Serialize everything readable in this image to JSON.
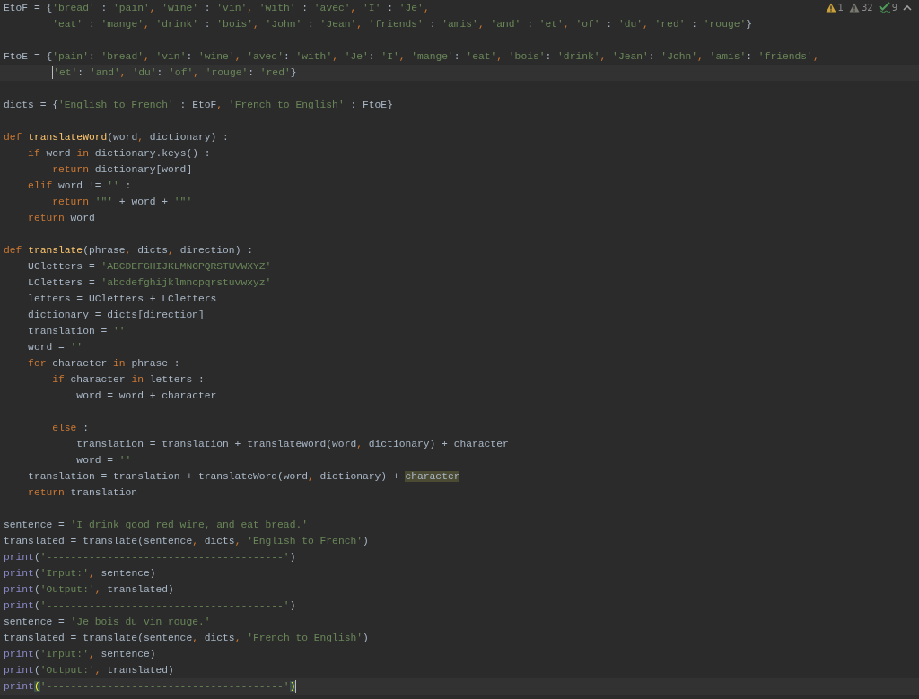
{
  "inspections": [
    {
      "kind": "warning",
      "count": "1"
    },
    {
      "kind": "weak-warning",
      "count": "32"
    },
    {
      "kind": "typo",
      "count": "9"
    }
  ],
  "editor": {
    "lines": [
      {
        "current": false,
        "tokens": [
          {
            "kind": "id",
            "text": "EtoF = {"
          },
          {
            "kind": "str",
            "text": "'bread'"
          },
          {
            "kind": "id",
            "text": " : "
          },
          {
            "kind": "str",
            "text": "'pain'"
          },
          {
            "kind": "comma",
            "text": ", "
          },
          {
            "kind": "str",
            "text": "'wine'"
          },
          {
            "kind": "id",
            "text": " : "
          },
          {
            "kind": "str",
            "text": "'vin'"
          },
          {
            "kind": "comma",
            "text": ", "
          },
          {
            "kind": "str",
            "text": "'with'"
          },
          {
            "kind": "id",
            "text": " : "
          },
          {
            "kind": "str",
            "text": "'avec'"
          },
          {
            "kind": "comma",
            "text": ", "
          },
          {
            "kind": "str",
            "text": "'I'"
          },
          {
            "kind": "id",
            "text": " : "
          },
          {
            "kind": "str",
            "text": "'Je'"
          },
          {
            "kind": "comma",
            "text": ","
          }
        ]
      },
      {
        "current": false,
        "tokens": [
          {
            "kind": "str",
            "text": "        'eat'"
          },
          {
            "kind": "id",
            "text": " : "
          },
          {
            "kind": "str",
            "text": "'mange'"
          },
          {
            "kind": "comma",
            "text": ", "
          },
          {
            "kind": "str",
            "text": "'drink'"
          },
          {
            "kind": "id",
            "text": " : "
          },
          {
            "kind": "str",
            "text": "'bois'"
          },
          {
            "kind": "comma",
            "text": ", "
          },
          {
            "kind": "str",
            "text": "'John'"
          },
          {
            "kind": "id",
            "text": " : "
          },
          {
            "kind": "str",
            "text": "'Jean'"
          },
          {
            "kind": "comma",
            "text": ", "
          },
          {
            "kind": "str",
            "text": "'friends'"
          },
          {
            "kind": "id",
            "text": " : "
          },
          {
            "kind": "str",
            "text": "'amis'"
          },
          {
            "kind": "comma",
            "text": ", "
          },
          {
            "kind": "str",
            "text": "'and'"
          },
          {
            "kind": "id",
            "text": " : "
          },
          {
            "kind": "str",
            "text": "'et'"
          },
          {
            "kind": "comma",
            "text": ", "
          },
          {
            "kind": "str",
            "text": "'of'"
          },
          {
            "kind": "id",
            "text": " : "
          },
          {
            "kind": "str",
            "text": "'du'"
          },
          {
            "kind": "comma",
            "text": ", "
          },
          {
            "kind": "str",
            "text": "'red'"
          },
          {
            "kind": "id",
            "text": " : "
          },
          {
            "kind": "str",
            "text": "'rouge'"
          },
          {
            "kind": "id",
            "text": "}"
          }
        ]
      },
      {
        "current": false
      },
      {
        "current": false,
        "tokens": [
          {
            "kind": "id",
            "text": "FtoE = {"
          },
          {
            "kind": "str",
            "text": "'pain'"
          },
          {
            "kind": "id",
            "text": ": "
          },
          {
            "kind": "str",
            "text": "'bread'"
          },
          {
            "kind": "comma",
            "text": ", "
          },
          {
            "kind": "str",
            "text": "'vin'"
          },
          {
            "kind": "id",
            "text": ": "
          },
          {
            "kind": "str",
            "text": "'wine'"
          },
          {
            "kind": "comma",
            "text": ", "
          },
          {
            "kind": "str",
            "text": "'avec'"
          },
          {
            "kind": "id",
            "text": ": "
          },
          {
            "kind": "str",
            "text": "'with'"
          },
          {
            "kind": "comma",
            "text": ", "
          },
          {
            "kind": "str",
            "text": "'Je'"
          },
          {
            "kind": "id",
            "text": ": "
          },
          {
            "kind": "str",
            "text": "'I'"
          },
          {
            "kind": "comma",
            "text": ", "
          },
          {
            "kind": "str",
            "text": "'mange'"
          },
          {
            "kind": "id",
            "text": ": "
          },
          {
            "kind": "str",
            "text": "'eat'"
          },
          {
            "kind": "comma",
            "text": ", "
          },
          {
            "kind": "str",
            "text": "'bois'"
          },
          {
            "kind": "id",
            "text": ": "
          },
          {
            "kind": "str",
            "text": "'drink'"
          },
          {
            "kind": "comma",
            "text": ", "
          },
          {
            "kind": "str",
            "text": "'Jean'"
          },
          {
            "kind": "id",
            "text": ": "
          },
          {
            "kind": "str",
            "text": "'John'"
          },
          {
            "kind": "comma",
            "text": ", "
          },
          {
            "kind": "str",
            "text": "'amis'"
          },
          {
            "kind": "id",
            "text": ": "
          },
          {
            "kind": "str",
            "text": "'friends'"
          },
          {
            "kind": "comma",
            "text": ","
          }
        ]
      },
      {
        "current": true,
        "tokens": [
          {
            "kind": "caret-str",
            "text": "        'et'"
          },
          {
            "kind": "id",
            "text": ": "
          },
          {
            "kind": "str",
            "text": "'and'"
          },
          {
            "kind": "comma",
            "text": ", "
          },
          {
            "kind": "str",
            "text": "'du'"
          },
          {
            "kind": "id",
            "text": ": "
          },
          {
            "kind": "str",
            "text": "'of'"
          },
          {
            "kind": "comma",
            "text": ", "
          },
          {
            "kind": "str",
            "text": "'rouge'"
          },
          {
            "kind": "id",
            "text": ": "
          },
          {
            "kind": "str",
            "text": "'red'"
          },
          {
            "kind": "id",
            "text": "}"
          }
        ]
      },
      {
        "current": false
      },
      {
        "current": false,
        "tokens": [
          {
            "kind": "id",
            "text": "dicts = {"
          },
          {
            "kind": "str",
            "text": "'English to French'"
          },
          {
            "kind": "id",
            "text": " : EtoF"
          },
          {
            "kind": "comma",
            "text": ", "
          },
          {
            "kind": "str",
            "text": "'French to English'"
          },
          {
            "kind": "id",
            "text": " : FtoE}"
          }
        ]
      },
      {
        "current": false
      },
      {
        "current": false,
        "tokens": [
          {
            "kind": "kw",
            "text": "def "
          },
          {
            "kind": "fn",
            "text": "translateWord"
          },
          {
            "kind": "id",
            "text": "(word"
          },
          {
            "kind": "comma",
            "text": ", "
          },
          {
            "kind": "id",
            "text": "dictionary) :"
          }
        ]
      },
      {
        "current": false,
        "tokens": [
          {
            "kind": "kw",
            "text": "    if "
          },
          {
            "kind": "id",
            "text": "word "
          },
          {
            "kind": "kw",
            "text": "in "
          },
          {
            "kind": "id",
            "text": "dictionary.keys() :"
          }
        ]
      },
      {
        "current": false,
        "tokens": [
          {
            "kind": "kw",
            "text": "        return "
          },
          {
            "kind": "id",
            "text": "dictionary[word]"
          }
        ]
      },
      {
        "current": false,
        "tokens": [
          {
            "kind": "kw",
            "text": "    elif "
          },
          {
            "kind": "id",
            "text": "word != "
          },
          {
            "kind": "str",
            "text": "''"
          },
          {
            "kind": "id",
            "text": " :"
          }
        ]
      },
      {
        "current": false,
        "tokens": [
          {
            "kind": "kw",
            "text": "        return "
          },
          {
            "kind": "str",
            "text": "'\"'"
          },
          {
            "kind": "id",
            "text": " + word + "
          },
          {
            "kind": "str",
            "text": "'\"'"
          }
        ]
      },
      {
        "current": false,
        "tokens": [
          {
            "kind": "kw",
            "text": "    return "
          },
          {
            "kind": "id",
            "text": "word"
          }
        ]
      },
      {
        "current": false
      },
      {
        "current": false,
        "tokens": [
          {
            "kind": "kw",
            "text": "def "
          },
          {
            "kind": "fn",
            "text": "translate"
          },
          {
            "kind": "id",
            "text": "(phrase"
          },
          {
            "kind": "comma",
            "text": ", "
          },
          {
            "kind": "id",
            "text": "dicts"
          },
          {
            "kind": "comma",
            "text": ", "
          },
          {
            "kind": "id",
            "text": "direction) :"
          }
        ]
      },
      {
        "current": false,
        "tokens": [
          {
            "kind": "id",
            "text": "    UCletters = "
          },
          {
            "kind": "str",
            "text": "'ABCDEFGHIJKLMNOPQRSTUVWXYZ'"
          }
        ]
      },
      {
        "current": false,
        "tokens": [
          {
            "kind": "id",
            "text": "    LCletters = "
          },
          {
            "kind": "str",
            "text": "'abcdefghijklmnopqrstuvwxyz'"
          }
        ]
      },
      {
        "current": false,
        "tokens": [
          {
            "kind": "id",
            "text": "    letters = UCletters + LCletters"
          }
        ]
      },
      {
        "current": false,
        "tokens": [
          {
            "kind": "id",
            "text": "    dictionary = dicts[direction]"
          }
        ]
      },
      {
        "current": false,
        "tokens": [
          {
            "kind": "id",
            "text": "    translation = "
          },
          {
            "kind": "str",
            "text": "''"
          }
        ]
      },
      {
        "current": false,
        "tokens": [
          {
            "kind": "id",
            "text": "    word = "
          },
          {
            "kind": "str",
            "text": "''"
          }
        ]
      },
      {
        "current": false,
        "tokens": [
          {
            "kind": "kw",
            "text": "    for "
          },
          {
            "kind": "id",
            "text": "character "
          },
          {
            "kind": "kw",
            "text": "in "
          },
          {
            "kind": "id",
            "text": "phrase :"
          }
        ]
      },
      {
        "current": false,
        "tokens": [
          {
            "kind": "kw",
            "text": "        if "
          },
          {
            "kind": "id",
            "text": "character "
          },
          {
            "kind": "kw",
            "text": "in "
          },
          {
            "kind": "id",
            "text": "letters :"
          }
        ]
      },
      {
        "current": false,
        "tokens": [
          {
            "kind": "id",
            "text": "            word = word + character"
          }
        ]
      },
      {
        "current": false
      },
      {
        "current": false,
        "tokens": [
          {
            "kind": "kw",
            "text": "        else"
          },
          {
            "kind": "id",
            "text": " :"
          }
        ]
      },
      {
        "current": false,
        "tokens": [
          {
            "kind": "id",
            "text": "            translation = translation + translateWord(word"
          },
          {
            "kind": "comma",
            "text": ", "
          },
          {
            "kind": "id",
            "text": "dictionary) + character"
          }
        ]
      },
      {
        "current": false,
        "tokens": [
          {
            "kind": "id",
            "text": "            word = "
          },
          {
            "kind": "str",
            "text": "''"
          }
        ]
      },
      {
        "current": false,
        "tokens": [
          {
            "kind": "id",
            "text": "    translation = translation + translateWord(word"
          },
          {
            "kind": "comma",
            "text": ", "
          },
          {
            "kind": "id",
            "text": "dictionary) + "
          },
          {
            "kind": "match",
            "text": "character"
          }
        ]
      },
      {
        "current": false,
        "tokens": [
          {
            "kind": "kw",
            "text": "    return "
          },
          {
            "kind": "id",
            "text": "translation"
          }
        ]
      },
      {
        "current": false
      },
      {
        "current": false,
        "tokens": [
          {
            "kind": "id",
            "text": "sentence = "
          },
          {
            "kind": "str",
            "text": "'I drink good red wine, and eat bread.'"
          }
        ]
      },
      {
        "current": false,
        "tokens": [
          {
            "kind": "id",
            "text": "translated = translate(sentence"
          },
          {
            "kind": "comma",
            "text": ", "
          },
          {
            "kind": "id",
            "text": "dicts"
          },
          {
            "kind": "comma",
            "text": ", "
          },
          {
            "kind": "str",
            "text": "'English to French'"
          },
          {
            "kind": "id",
            "text": ")"
          }
        ]
      },
      {
        "current": false,
        "tokens": [
          {
            "kind": "builtin",
            "text": "print"
          },
          {
            "kind": "id",
            "text": "("
          },
          {
            "kind": "str",
            "text": "'---------------------------------------'"
          },
          {
            "kind": "id",
            "text": ")"
          }
        ]
      },
      {
        "current": false,
        "tokens": [
          {
            "kind": "builtin",
            "text": "print"
          },
          {
            "kind": "id",
            "text": "("
          },
          {
            "kind": "str",
            "text": "'Input:'"
          },
          {
            "kind": "comma",
            "text": ", "
          },
          {
            "kind": "id",
            "text": "sentence)"
          }
        ]
      },
      {
        "current": false,
        "tokens": [
          {
            "kind": "builtin",
            "text": "print"
          },
          {
            "kind": "id",
            "text": "("
          },
          {
            "kind": "str",
            "text": "'Output:'"
          },
          {
            "kind": "comma",
            "text": ", "
          },
          {
            "kind": "id",
            "text": "translated)"
          }
        ]
      },
      {
        "current": false,
        "tokens": [
          {
            "kind": "builtin",
            "text": "print"
          },
          {
            "kind": "id",
            "text": "("
          },
          {
            "kind": "str",
            "text": "'---------------------------------------'"
          },
          {
            "kind": "id",
            "text": ")"
          }
        ]
      },
      {
        "current": false,
        "tokens": [
          {
            "kind": "id",
            "text": "sentence = "
          },
          {
            "kind": "str",
            "text": "'Je bois du vin rouge.'"
          }
        ]
      },
      {
        "current": false,
        "tokens": [
          {
            "kind": "id",
            "text": "translated = translate(sentence"
          },
          {
            "kind": "comma",
            "text": ", "
          },
          {
            "kind": "id",
            "text": "dicts"
          },
          {
            "kind": "comma",
            "text": ", "
          },
          {
            "kind": "str",
            "text": "'French to English'"
          },
          {
            "kind": "id",
            "text": ")"
          }
        ]
      },
      {
        "current": false,
        "tokens": [
          {
            "kind": "builtin",
            "text": "print"
          },
          {
            "kind": "id",
            "text": "("
          },
          {
            "kind": "str",
            "text": "'Input:'"
          },
          {
            "kind": "comma",
            "text": ", "
          },
          {
            "kind": "id",
            "text": "sentence)"
          }
        ]
      },
      {
        "current": false,
        "tokens": [
          {
            "kind": "builtin",
            "text": "print"
          },
          {
            "kind": "id",
            "text": "("
          },
          {
            "kind": "str",
            "text": "'Output:'"
          },
          {
            "kind": "comma",
            "text": ", "
          },
          {
            "kind": "id",
            "text": "translated)"
          }
        ]
      },
      {
        "current": true,
        "tokens": [
          {
            "kind": "builtin",
            "text": "print"
          },
          {
            "kind": "brace",
            "text": "("
          },
          {
            "kind": "str",
            "text": "'---------------------------------------'"
          },
          {
            "kind": "brace",
            "text": ")"
          },
          {
            "kind": "caret-end"
          }
        ]
      }
    ]
  }
}
